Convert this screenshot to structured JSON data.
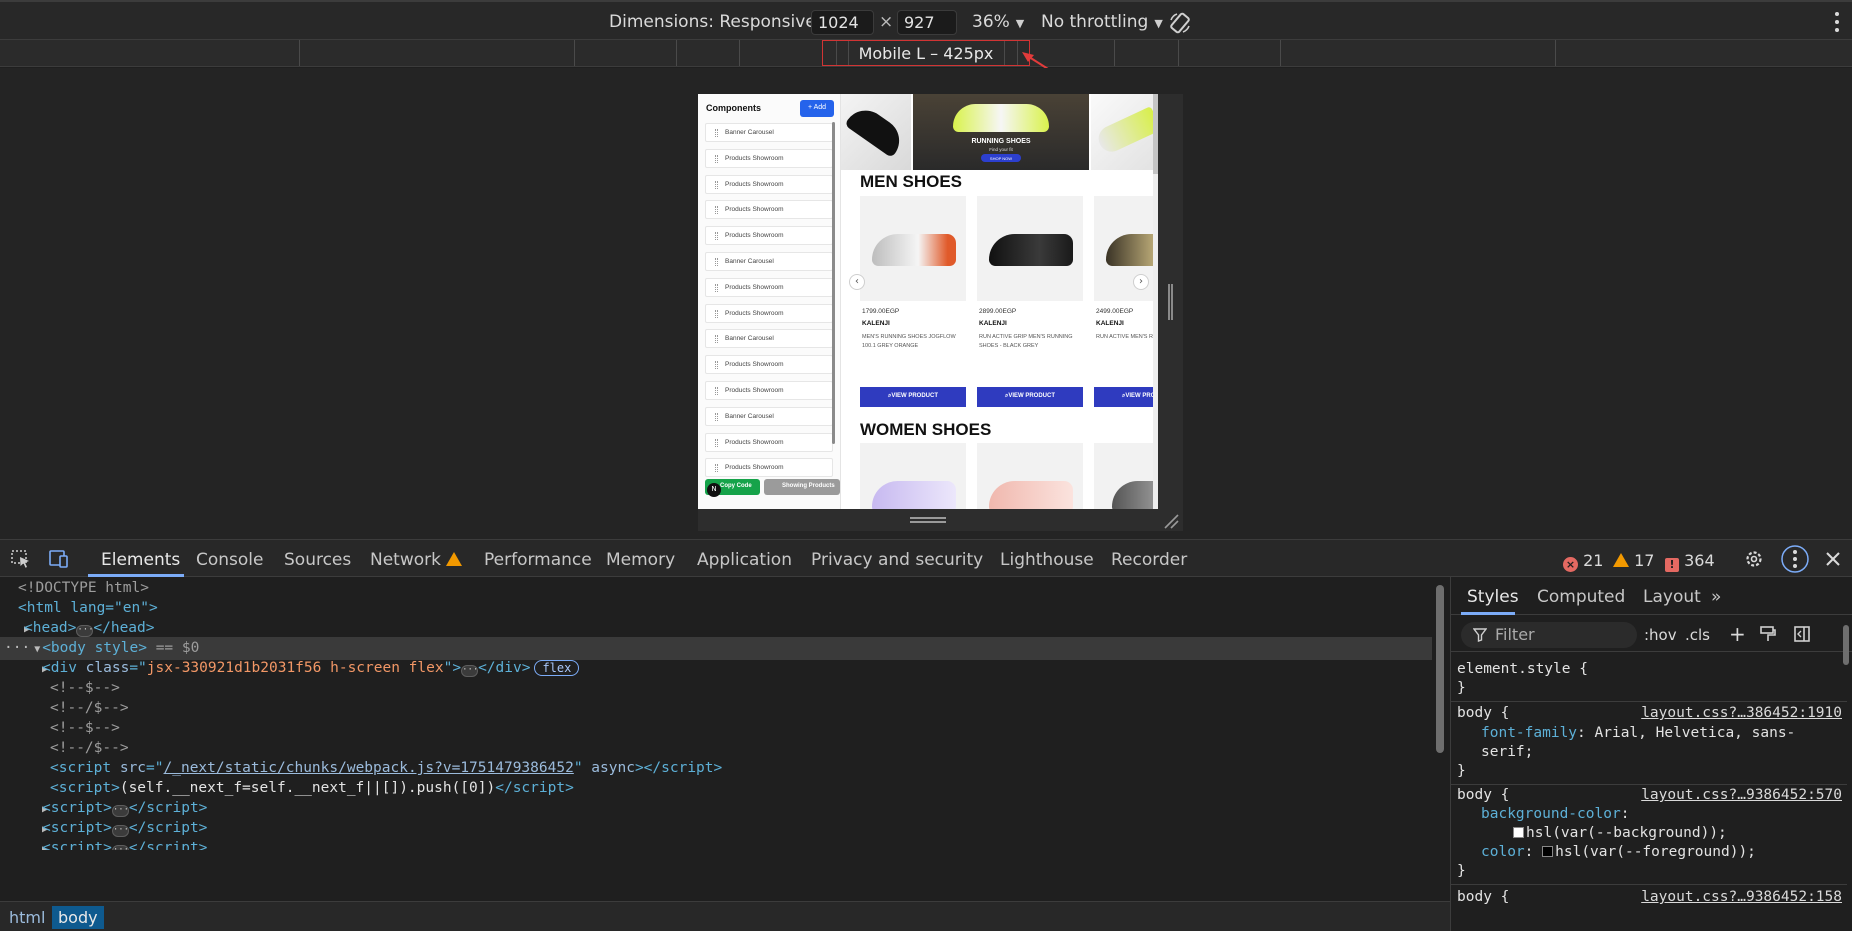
{
  "toolbar": {
    "dimensions_label": "Dimensions: Responsive",
    "width": "1024",
    "height": "927",
    "times": "×",
    "zoom": "36%",
    "throttle": "No throttling"
  },
  "media_query": {
    "label": "Mobile L – 425px"
  },
  "app": {
    "sidebar_title": "Components",
    "add_label": "+ Add",
    "components": [
      "Banner Carousel",
      "Products Showroom",
      "Products Showroom",
      "Products Showroom",
      "Products Showroom",
      "Banner Carousel",
      "Products Showroom",
      "Products Showroom",
      "Banner Carousel",
      "Products Showroom",
      "Products Showroom",
      "Banner Carousel",
      "Products Showroom",
      "Products Showroom"
    ],
    "copy_label": "Copy Code",
    "showing_label": "Showing Products",
    "n_badge": "N",
    "banner_title": "RUNNING SHOES",
    "banner_sub": "Find your fit",
    "banner_btn": "SHOP NOW",
    "men_title": "MEN SHOES",
    "women_title": "WOMEN SHOES",
    "men_products": [
      {
        "price": "1799.00EGP",
        "brand": "KALENJI",
        "desc": "MEN'S RUNNING SHOES JOGFLOW 100.1 GREY ORANGE",
        "cta": "VIEW PRODUCT"
      },
      {
        "price": "2899.00EGP",
        "brand": "KALENJI",
        "desc": "RUN ACTIVE GRIP MEN'S RUNNING SHOES - BLACK GREY",
        "cta": "VIEW PRODUCT"
      },
      {
        "price": "2499.00EGP",
        "brand": "KALENJI",
        "desc": "RUN ACTIVE MEN'S RUNNING SHOES",
        "cta": "VIEW PRODUCT"
      }
    ],
    "prev_arrow": "‹",
    "next_arrow": "›"
  },
  "devtools": {
    "tabs": [
      "Elements",
      "Console",
      "Sources",
      "Network",
      "Performance",
      "Memory",
      "Application",
      "Privacy and security",
      "Lighthouse",
      "Recorder"
    ],
    "errors": "21",
    "warnings": "17",
    "issues": "364",
    "elements": {
      "doctype": "<!DOCTYPE html>",
      "html_open": "<html lang=\"en\">",
      "head": "<head>",
      "head_close": "</head>",
      "body": "<body style>",
      "body_suffix": "== $0",
      "div_class": "jsx-330921d1b2031f56 h-screen flex",
      "flex_badge": "flex",
      "comments": [
        "<!--$-->",
        "<!--/$-->",
        "<!--$-->",
        "<!--/$-->"
      ],
      "script_src": "/_next/static/chunks/webpack.js?v=1751479386452",
      "script_inline": "(self.__next_f=self.__next_f||[]).push([0])"
    },
    "breadcrumbs": [
      "html",
      "body"
    ],
    "styles": {
      "tabs": [
        "Styles",
        "Computed",
        "Layout"
      ],
      "filter_placeholder": "Filter",
      "hov": ":hov",
      "cls": ".cls",
      "element_style": "element.style {",
      "rules": [
        {
          "selector": "body {",
          "source": "layout.css?…386452:1910",
          "props": [
            [
              "font-family",
              "Arial, Helvetica, sans-serif;"
            ]
          ]
        },
        {
          "selector": "body {",
          "source": "layout.css?…9386452:570",
          "props": [
            [
              "background-color",
              "hsl(var(--background));"
            ],
            [
              "color",
              "hsl(var(--foreground));"
            ]
          ]
        },
        {
          "selector": "body {",
          "source": "layout.css?…9386452:158",
          "props": []
        }
      ]
    }
  },
  "colors": {
    "accent": "#7cacf8",
    "error": "#e46962",
    "warning": "#f29900",
    "view_button": "#2f3bbf",
    "add_button": "#2563eb",
    "copy_button": "#16a34a"
  }
}
